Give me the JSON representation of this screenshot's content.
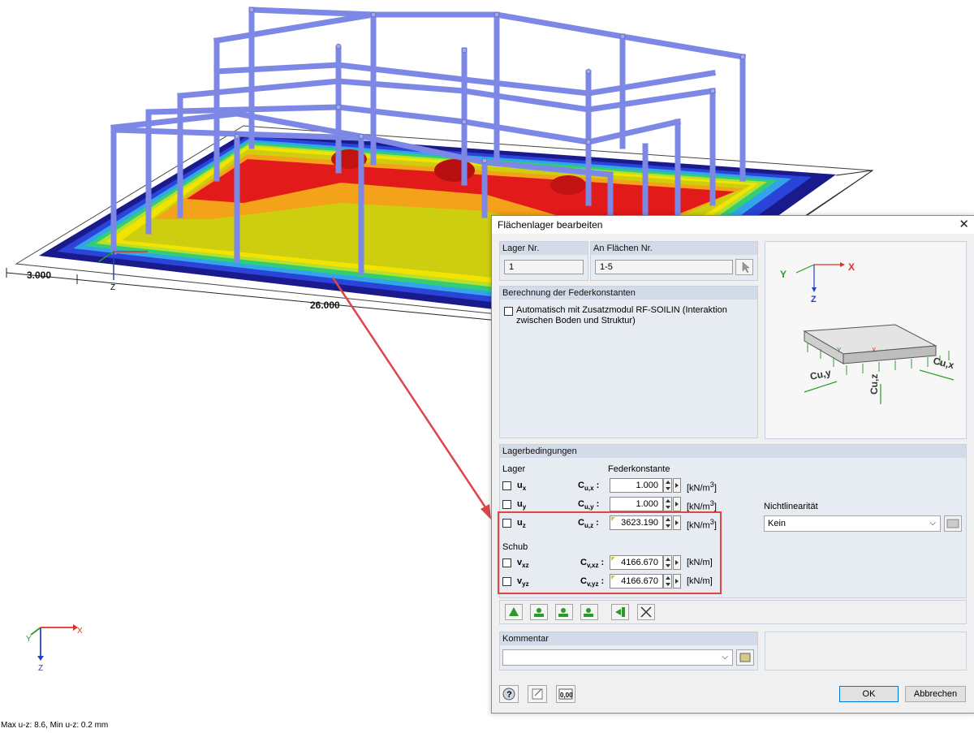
{
  "viewport": {
    "dimensions": [
      "3.000",
      "26.000"
    ],
    "axes_labels": {
      "x": "X",
      "y": "Y",
      "z": "Z"
    },
    "status_text": "Max u-z: 8.6, Min u-z: 0.2 mm"
  },
  "dialog": {
    "title": "Flächenlager bearbeiten",
    "lager_nr": {
      "label": "Lager Nr.",
      "value": "1"
    },
    "an_flaechen": {
      "label": "An Flächen Nr.",
      "value": "1-5"
    },
    "federkonstanten": {
      "header": "Berechnung der Federkonstanten",
      "auto_label": "Automatisch mit Zusatzmodul RF-SOILIN (Interaktion zwischen Boden und Struktur)",
      "auto_checked": false
    },
    "lagerbedingungen": {
      "header": "Lagerbedingungen",
      "lager_label": "Lager",
      "feder_label": "Federkonstante",
      "rows": [
        {
          "name": "u",
          "sub": "x",
          "const": "C",
          "const_sub": "u,x",
          "value": "1.000",
          "unit": "[kN/m",
          "unit_sup": "3",
          "checked": false
        },
        {
          "name": "u",
          "sub": "y",
          "const": "C",
          "const_sub": "u,y",
          "value": "1.000",
          "unit": "[kN/m",
          "unit_sup": "3",
          "checked": false
        },
        {
          "name": "u",
          "sub": "z",
          "const": "C",
          "const_sub": "u,z",
          "value": "3623.190",
          "unit": "[kN/m",
          "unit_sup": "3",
          "checked": false
        }
      ],
      "schub_label": "Schub",
      "schub_rows": [
        {
          "name": "v",
          "sub": "xz",
          "const": "C",
          "const_sub": "v,xz",
          "value": "4166.670",
          "unit": "[kN/m]",
          "checked": false
        },
        {
          "name": "v",
          "sub": "yz",
          "const": "C",
          "const_sub": "v,yz",
          "value": "4166.670",
          "unit": "[kN/m]",
          "checked": false
        }
      ],
      "nichtlinearitaet_label": "Nichtlinearität",
      "nichtlinearitaet_value": "Kein"
    },
    "kommentar": {
      "header": "Kommentar",
      "value": ""
    },
    "diagram": {
      "x": "X",
      "y": "Y",
      "z": "Z",
      "cux": "Cu,x",
      "cuy": "Cu,y",
      "cuz": "Cu,z"
    },
    "buttons": {
      "ok": "OK",
      "cancel": "Abbrechen",
      "units_icon": "0,00"
    },
    "colors": {
      "highlight": "#e04545",
      "accent": "#0078d7"
    }
  }
}
